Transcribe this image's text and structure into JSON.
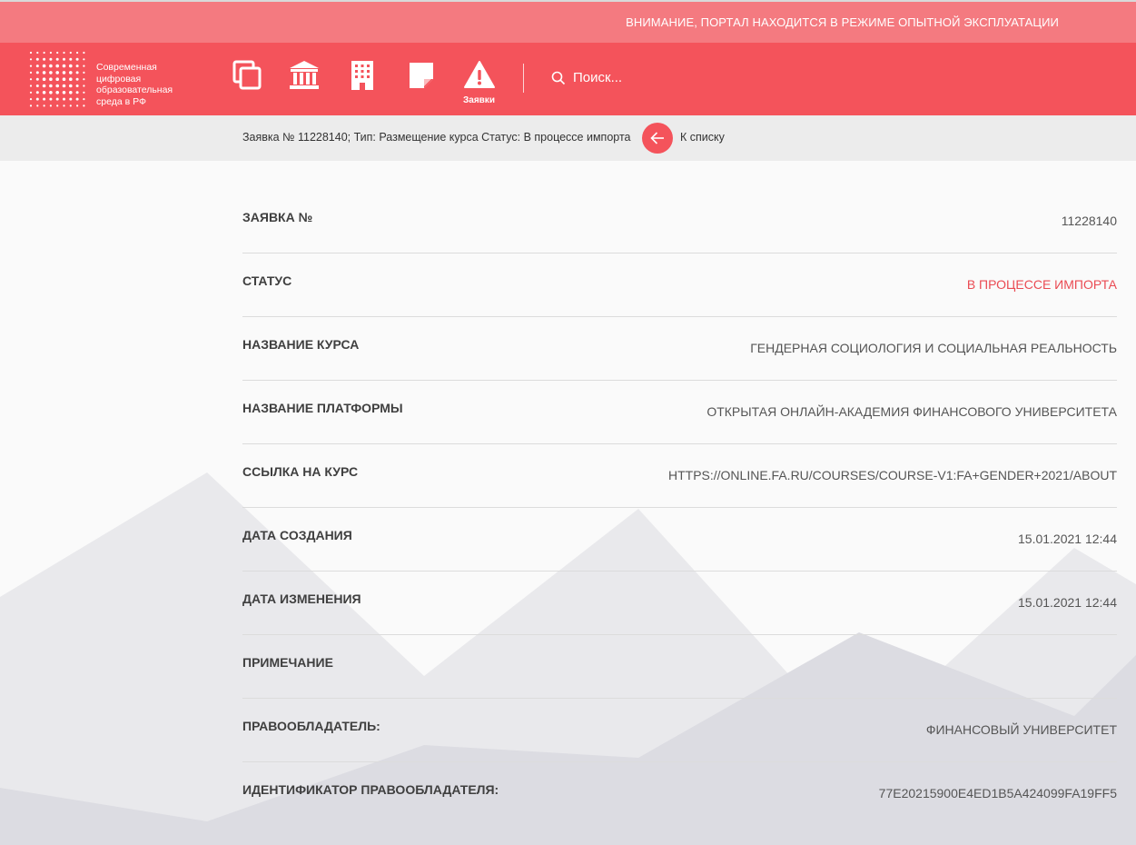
{
  "notice": {
    "text": "ВНИМАНИЕ, ПОРТАЛ НАХОДИТСЯ В РЕЖИМЕ ОПЫТНОЙ ЭКСПЛУАТАЦИИ"
  },
  "logo": {
    "lines": [
      "Современная",
      "цифровая",
      "образовательная",
      "среда в РФ"
    ]
  },
  "nav": {
    "icons": [
      "copy-icon",
      "institution-icon",
      "building-icon",
      "note-icon",
      "warning-icon"
    ],
    "active_label": "Заявки"
  },
  "search": {
    "placeholder": "Поиск..."
  },
  "breadcrumb": {
    "info": "Заявка № 11228140; Тип: Размещение курса Статус: В процессе импорта",
    "back_label": "К списку"
  },
  "colors": {
    "brand": "#f4535b",
    "notice_bg": "#f47a80",
    "status": "#ea4b53"
  },
  "details": [
    {
      "label": "ЗАЯВКА №",
      "value": "11228140"
    },
    {
      "label": "СТАТУС",
      "value": "В ПРОЦЕССЕ ИМПОРТА"
    },
    {
      "label": "НАЗВАНИЕ КУРСА",
      "value": "ГЕНДЕРНАЯ СОЦИОЛОГИЯ И СОЦИАЛЬНАЯ РЕАЛЬНОСТЬ"
    },
    {
      "label": "НАЗВАНИЕ ПЛАТФОРМЫ",
      "value": "ОТКРЫТАЯ ОНЛАЙН-АКАДЕМИЯ ФИНАНСОВОГО УНИВЕРСИТЕТА"
    },
    {
      "label": "ССЫЛКА НА КУРС",
      "value": "HTTPS://ONLINE.FA.RU/COURSES/COURSE-V1:FA+GENDER+2021/ABOUT"
    },
    {
      "label": "ДАТА СОЗДАНИЯ",
      "value": "15.01.2021 12:44"
    },
    {
      "label": "ДАТА ИЗМЕНЕНИЯ",
      "value": "15.01.2021 12:44"
    },
    {
      "label": "ПРИМЕЧАНИЕ",
      "value": ""
    },
    {
      "label": "ПРАВООБЛАДАТЕЛЬ:",
      "value": "ФИНАНСОВЫЙ УНИВЕРСИТЕТ"
    },
    {
      "label": "ИДЕНТИФИКАТОР ПРАВООБЛАДАТЕЛЯ:",
      "value": "77E20215900E4ED1B5A424099FA19FF5"
    }
  ]
}
